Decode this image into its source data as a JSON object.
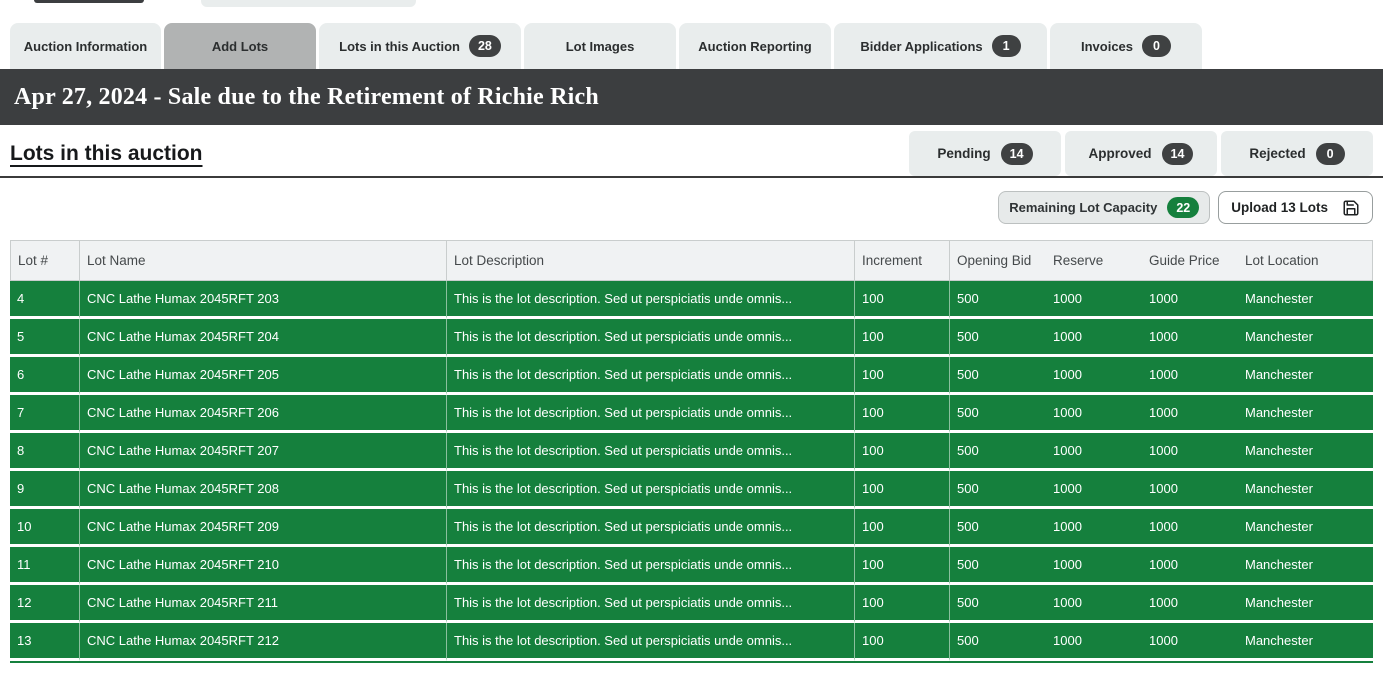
{
  "tabs": [
    {
      "label": "Auction Information",
      "active": false,
      "badge": null
    },
    {
      "label": "Add Lots",
      "active": true,
      "badge": null
    },
    {
      "label": "Lots in this Auction",
      "active": false,
      "badge": "28"
    },
    {
      "label": "Lot Images",
      "active": false,
      "badge": null
    },
    {
      "label": "Auction Reporting",
      "active": false,
      "badge": null
    },
    {
      "label": "Bidder Applications",
      "active": false,
      "badge": "1"
    },
    {
      "label": "Invoices",
      "active": false,
      "badge": "0"
    }
  ],
  "banner": {
    "title": "Apr 27, 2024 - Sale due to the Retirement of Richie Rich"
  },
  "section": {
    "heading": "Lots in this auction"
  },
  "status_filters": [
    {
      "label": "Pending",
      "badge": "14"
    },
    {
      "label": "Approved",
      "badge": "14"
    },
    {
      "label": "Rejected",
      "badge": "0"
    }
  ],
  "toolbar": {
    "remaining_capacity_label": "Remaining Lot Capacity",
    "remaining_capacity_badge": "22",
    "upload_button_label": "Upload 13 Lots",
    "upload_icon": "save-floppy-icon"
  },
  "table": {
    "columns": [
      "Lot #",
      "Lot Name",
      "Lot Description",
      "Increment",
      "Opening Bid",
      "Reserve",
      "Guide Price",
      "Lot Location"
    ],
    "rows": [
      [
        "4",
        "CNC Lathe Humax 2045RFT 203",
        "This is the lot description. Sed ut perspiciatis unde omnis...",
        "100",
        "500",
        "1000",
        "1000",
        "Manchester"
      ],
      [
        "5",
        "CNC Lathe Humax 2045RFT 204",
        "This is the lot description. Sed ut perspiciatis unde omnis...",
        "100",
        "500",
        "1000",
        "1000",
        "Manchester"
      ],
      [
        "6",
        "CNC Lathe Humax 2045RFT 205",
        "This is the lot description. Sed ut perspiciatis unde omnis...",
        "100",
        "500",
        "1000",
        "1000",
        "Manchester"
      ],
      [
        "7",
        "CNC Lathe Humax 2045RFT 206",
        "This is the lot description. Sed ut perspiciatis unde omnis...",
        "100",
        "500",
        "1000",
        "1000",
        "Manchester"
      ],
      [
        "8",
        "CNC Lathe Humax 2045RFT 207",
        "This is the lot description. Sed ut perspiciatis unde omnis...",
        "100",
        "500",
        "1000",
        "1000",
        "Manchester"
      ],
      [
        "9",
        "CNC Lathe Humax 2045RFT 208",
        "This is the lot description. Sed ut perspiciatis unde omnis...",
        "100",
        "500",
        "1000",
        "1000",
        "Manchester"
      ],
      [
        "10",
        "CNC Lathe Humax 2045RFT 209",
        "This is the lot description. Sed ut perspiciatis unde omnis...",
        "100",
        "500",
        "1000",
        "1000",
        "Manchester"
      ],
      [
        "11",
        "CNC Lathe Humax 2045RFT 210",
        "This is the lot description. Sed ut perspiciatis unde omnis...",
        "100",
        "500",
        "1000",
        "1000",
        "Manchester"
      ],
      [
        "12",
        "CNC Lathe Humax 2045RFT 211",
        "This is the lot description. Sed ut perspiciatis unde omnis...",
        "100",
        "500",
        "1000",
        "1000",
        "Manchester"
      ],
      [
        "13",
        "CNC Lathe Humax 2045RFT 212",
        "This is the lot description. Sed ut perspiciatis unde omnis...",
        "100",
        "500",
        "1000",
        "1000",
        "Manchester"
      ]
    ]
  },
  "colors": {
    "row_green": "#15803D",
    "badge_green": "#15803D",
    "badge_dark": "#3F4142",
    "banner_bg": "#3C3E40",
    "tab_active": "#B1B3B3",
    "tab_inactive": "#E9EDED"
  }
}
